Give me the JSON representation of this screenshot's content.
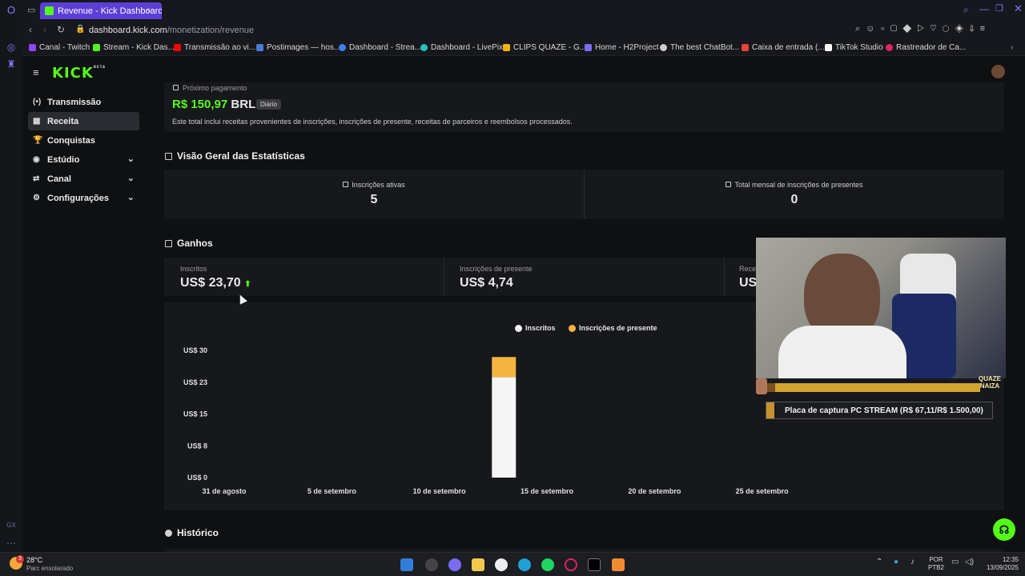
{
  "browser": {
    "tab_title": "Revenue - Kick Dashboard",
    "url_domain": "dashboard.kick.com",
    "url_path": "/monetization/revenue",
    "bookmarks": [
      {
        "label": "Canal - Twitch",
        "color": "#9146ff"
      },
      {
        "label": "Stream - Kick Das...",
        "color": "#53fc18"
      },
      {
        "label": "Transmissão ao vi...",
        "color": "#ff0000"
      },
      {
        "label": "Postimages — hos...",
        "color": "#4a7bd6"
      },
      {
        "label": "Dashboard - Strea...",
        "color": "#3b82f6"
      },
      {
        "label": "Dashboard - LivePix",
        "color": "#22c1c3"
      },
      {
        "label": "CLIPS QUAZE - G...",
        "color": "#f4b400"
      },
      {
        "label": "Home - H2Project",
        "color": "#7c6cf2"
      },
      {
        "label": "The best ChatBot...",
        "color": "#cccccc"
      },
      {
        "label": "Caixa de entrada (...",
        "color": "#ea4335"
      },
      {
        "label": "TikTok Studio",
        "color": "#ffffff"
      },
      {
        "label": "Rastreador de Ca...",
        "color": "#e0245e"
      }
    ]
  },
  "app": {
    "logo": "KICK",
    "logo_badge": "BETA"
  },
  "sidebar": {
    "items": [
      {
        "label": "Transmissão",
        "icon": "broadcast-icon",
        "glyph": "(•)",
        "expandable": false
      },
      {
        "label": "Receita",
        "icon": "revenue-icon",
        "glyph": "▦",
        "expandable": false,
        "active": true
      },
      {
        "label": "Conquistas",
        "icon": "trophy-icon",
        "glyph": "🏆",
        "expandable": false
      },
      {
        "label": "Estúdio",
        "icon": "studio-icon",
        "glyph": "◉",
        "expandable": true
      },
      {
        "label": "Canal",
        "icon": "channel-icon",
        "glyph": "⇄",
        "expandable": true
      },
      {
        "label": "Configurações",
        "icon": "gear-icon",
        "glyph": "⚙",
        "expandable": true
      }
    ]
  },
  "payment": {
    "label": "Próximo pagamento",
    "amount": "R$ 150,97",
    "currency": "BRL",
    "frequency_badge": "Diário",
    "note": "Este total inclui receitas provenientes de inscrições, inscrições de presente, receitas de parceiros e reembolsos processados."
  },
  "stats": {
    "title": "Visão Geral das Estatísticas",
    "items": [
      {
        "label": "Inscrições ativas",
        "value": "5"
      },
      {
        "label": "Total mensal de inscrições de presentes",
        "value": "0"
      }
    ]
  },
  "earnings": {
    "title": "Ganhos",
    "cards": [
      {
        "label": "Inscritos",
        "value": "US$ 23,70",
        "trend": "up"
      },
      {
        "label": "Inscrições de presente",
        "value": "US$ 4,74"
      },
      {
        "label": "Rece",
        "value": "US"
      }
    ]
  },
  "chart_data": {
    "type": "bar",
    "stacked": true,
    "legend": [
      "Inscritos",
      "Inscrições de presente"
    ],
    "legend_position": "top-center",
    "series": [
      {
        "name": "Inscritos",
        "color": "#f5f5f5",
        "points": [
          {
            "x": "2025-09-13",
            "y": 23.7
          }
        ]
      },
      {
        "name": "Inscrições de presente",
        "color": "#f4b33f",
        "points": [
          {
            "x": "2025-09-13",
            "y": 4.74
          }
        ]
      }
    ],
    "y_ticks": [
      "US$ 0",
      "US$ 8",
      "US$ 15",
      "US$ 23",
      "US$ 30"
    ],
    "ylim": [
      0,
      30
    ],
    "x_ticks": [
      "31 de agosto",
      "5 de setembro",
      "10 de setembro",
      "15 de setembro",
      "20 de setembro",
      "25 de setembro"
    ],
    "xlim": [
      "2025-08-31",
      "2025-09-30"
    ]
  },
  "history": {
    "title": "Histórico"
  },
  "overlay": {
    "ticker": "Placa de captura PC STREAM (R$ 67,11/R$ 1.500,00)",
    "brand": "QUAZE NAIZA",
    "progress": 0.0447
  },
  "taskbar": {
    "weather_temp": "28°C",
    "weather_desc": "Parc ensolarado",
    "weather_badge": "3",
    "lang_1": "POR",
    "lang_2": "PTB2",
    "time": "12:35",
    "date": "13/09/2025",
    "opera_gx": "GX"
  }
}
